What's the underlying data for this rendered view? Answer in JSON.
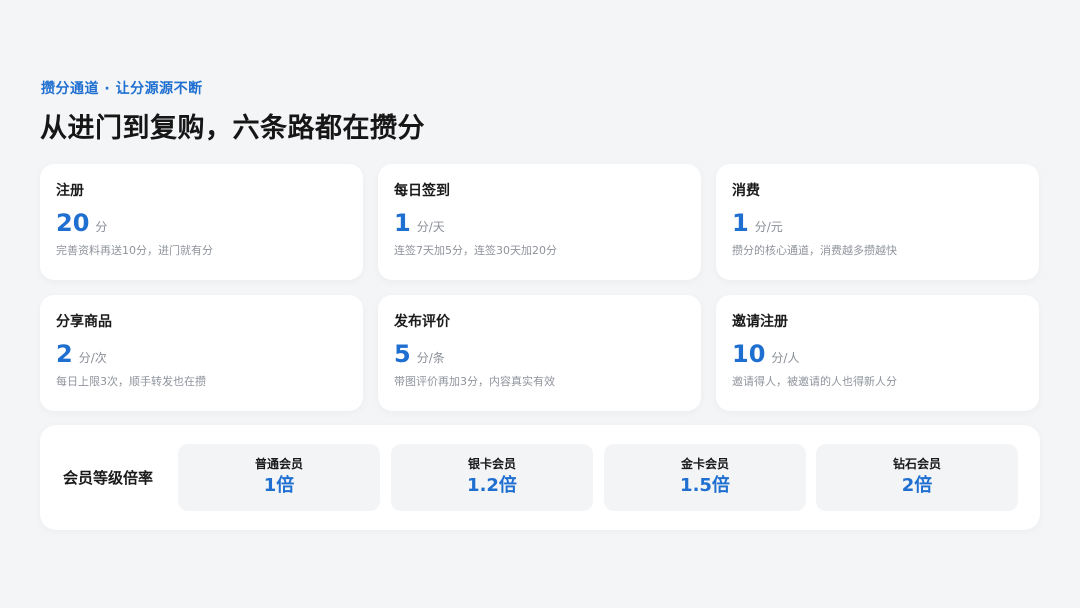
{
  "header": {
    "eyebrow": "攒分通道 · 让分源源不断",
    "headline": "从进门到复购，六条路都在攒分"
  },
  "cards": [
    {
      "title": "注册",
      "value": "20",
      "unit": "分",
      "desc": "完善资料再送10分，进门就有分"
    },
    {
      "title": "每日签到",
      "value": "1",
      "unit": "分/天",
      "desc": "连签7天加5分，连签30天加20分"
    },
    {
      "title": "消费",
      "value": "1",
      "unit": "分/元",
      "desc": "攒分的核心通道，消费越多攒越快"
    },
    {
      "title": "分享商品",
      "value": "2",
      "unit": "分/次",
      "desc": "每日上限3次，顺手转发也在攒"
    },
    {
      "title": "发布评价",
      "value": "5",
      "unit": "分/条",
      "desc": "带图评价再加3分，内容真实有效"
    },
    {
      "title": "邀请注册",
      "value": "10",
      "unit": "分/人",
      "desc": "邀请得人，被邀请的人也得新人分"
    }
  ],
  "tiers": {
    "label": "会员等级倍率",
    "items": [
      {
        "name": "普通会员",
        "multiplier": "1倍"
      },
      {
        "name": "银卡会员",
        "multiplier": "1.2倍"
      },
      {
        "name": "金卡会员",
        "multiplier": "1.5倍"
      },
      {
        "name": "钻石会员",
        "multiplier": "2倍"
      }
    ]
  },
  "colors": {
    "accent": "#1f6fd1",
    "background": "#f4f5f7",
    "card": "#ffffff"
  }
}
